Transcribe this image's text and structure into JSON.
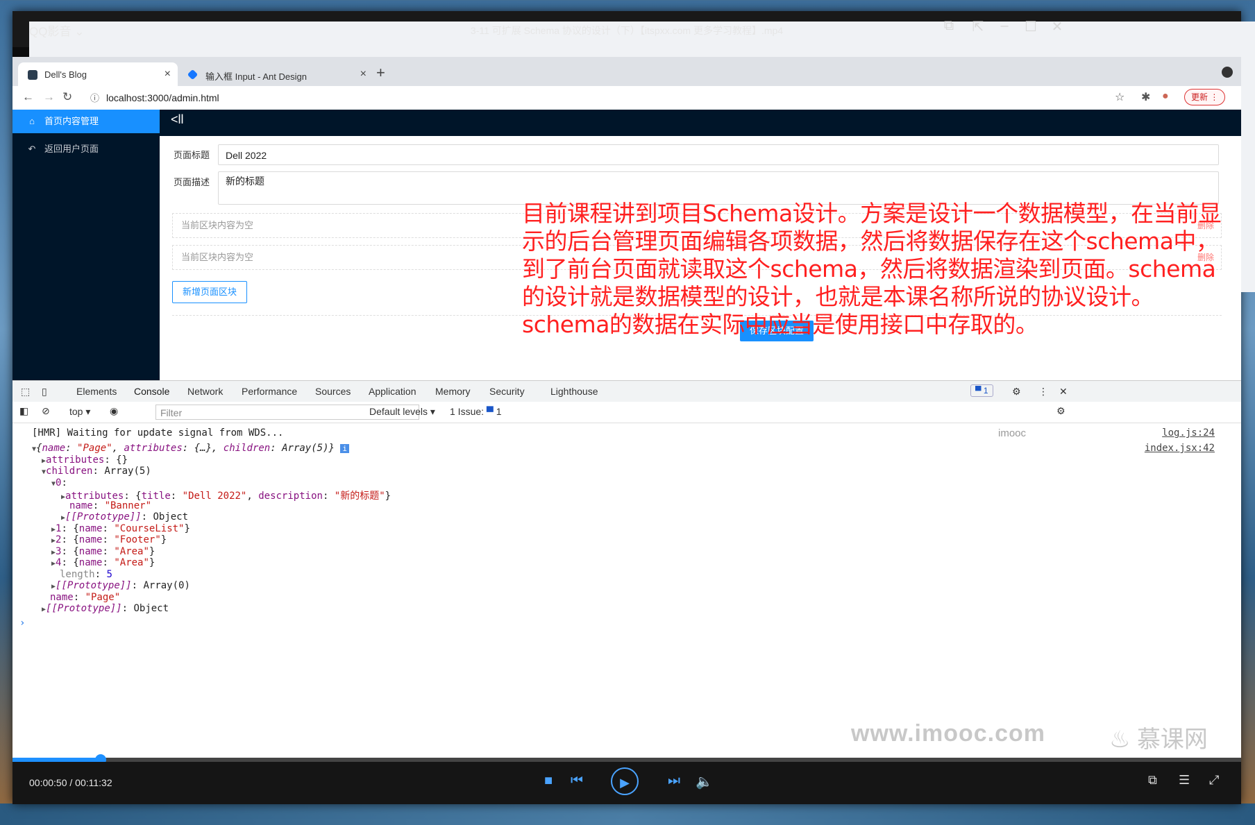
{
  "player": {
    "app_name": "QQ影音",
    "file_title": "3-11 可扩展 Schema 协议的设计（下）【itspxx.com 更多学习教程】.mp4",
    "time": "00:00:50 / 00:11:32",
    "progress_fraction": 0.072
  },
  "browser": {
    "tabs": [
      {
        "label": "Dell's Blog",
        "active": true
      },
      {
        "label": "输入框 Input - Ant Design",
        "active": false
      }
    ],
    "url": "localhost:3000/admin.html",
    "update_label": "更新"
  },
  "admin": {
    "sidebar": [
      {
        "label": "首页内容管理",
        "active": true
      },
      {
        "label": "返回用户页面",
        "active": false
      }
    ],
    "form": {
      "title_label": "页面标题",
      "title_value": "Dell 2022",
      "desc_label": "页面描述",
      "desc_value": "新的标题",
      "block_placeholder_1": "当前区块内容为空",
      "block_placeholder_2": "当前区块内容为空",
      "delete_label": "删除",
      "add_block": "新增页面区块",
      "save_block": "保存区块配置"
    },
    "annotation": "目前课程讲到项目Schema设计。方案是设计一个数据模型，在当前显示的后台管理页面编辑各项数据，然后将数据保存在这个schema中，到了前台页面就读取这个schema，然后将数据渲染到页面。schema的设计就是数据模型的设计，也就是本课名称所说的协议设计。schema的数据在实际中应当是使用接口中存取的。"
  },
  "devtools": {
    "tabs": [
      "Elements",
      "Console",
      "Network",
      "Performance",
      "Sources",
      "Application",
      "Memory",
      "Security",
      "Lighthouse"
    ],
    "active_tab": "Console",
    "issue_badge": "1",
    "context": "top",
    "filter_placeholder": "Filter",
    "levels": "Default levels",
    "issues_label": "1 Issue:",
    "issues_count": "1",
    "watermark_tag": "imooc",
    "console_lines": {
      "hmr": "[HMR] Waiting for update signal from WDS...",
      "hmr_src": "log.js:24",
      "obj_src": "index.jsx:42"
    }
  },
  "watermark": {
    "site": "www.imooc.com",
    "brand": "慕课网"
  },
  "colors": {
    "accent": "#1890ff",
    "sidebar_bg": "#001529",
    "annotation": "#ff2020",
    "player_blue": "#4aa3ff"
  }
}
